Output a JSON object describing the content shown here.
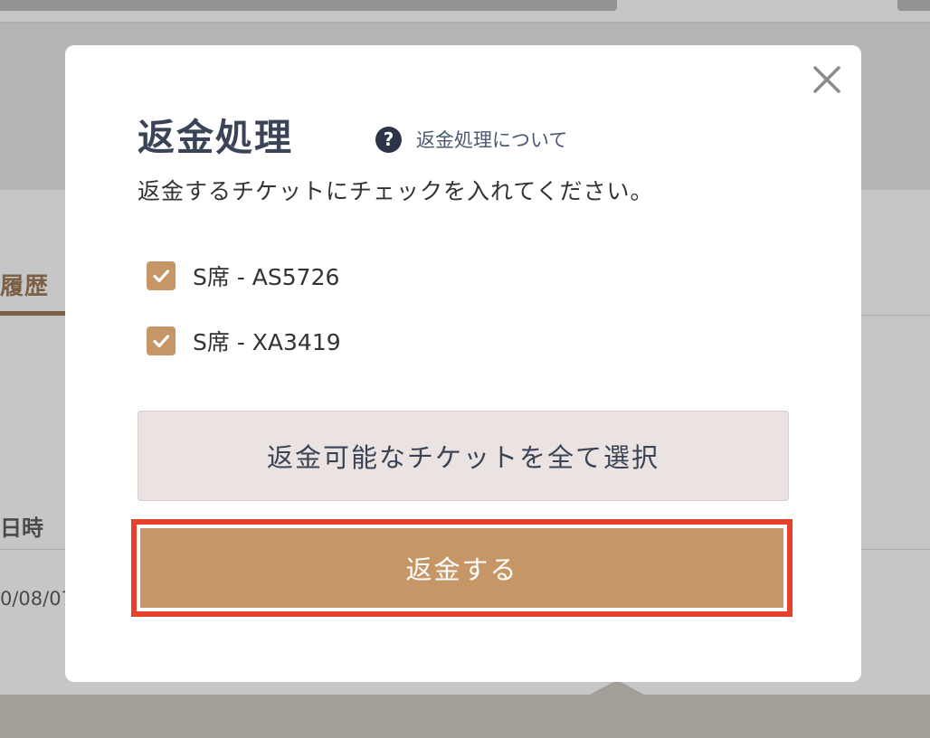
{
  "background": {
    "tab_label": "履歴",
    "column_label": "日時",
    "date_value": "0/08/07"
  },
  "modal": {
    "title": "返金処理",
    "help_link_label": "返金処理について",
    "help_icon": "question-circle-icon",
    "close_icon": "close-icon",
    "instruction": "返金するチケットにチェックを入れてください。",
    "tickets": [
      {
        "label": "S席 - AS5726",
        "checked": true
      },
      {
        "label": "S席 - XA3419",
        "checked": true
      }
    ],
    "select_all_label": "返金可能なチケットを全て選択",
    "refund_label": "返金する"
  },
  "colors": {
    "accent": "#c69666",
    "highlight_border": "#e8412a",
    "title": "#3a4456",
    "secondary_button_bg": "#ebe3e1"
  }
}
